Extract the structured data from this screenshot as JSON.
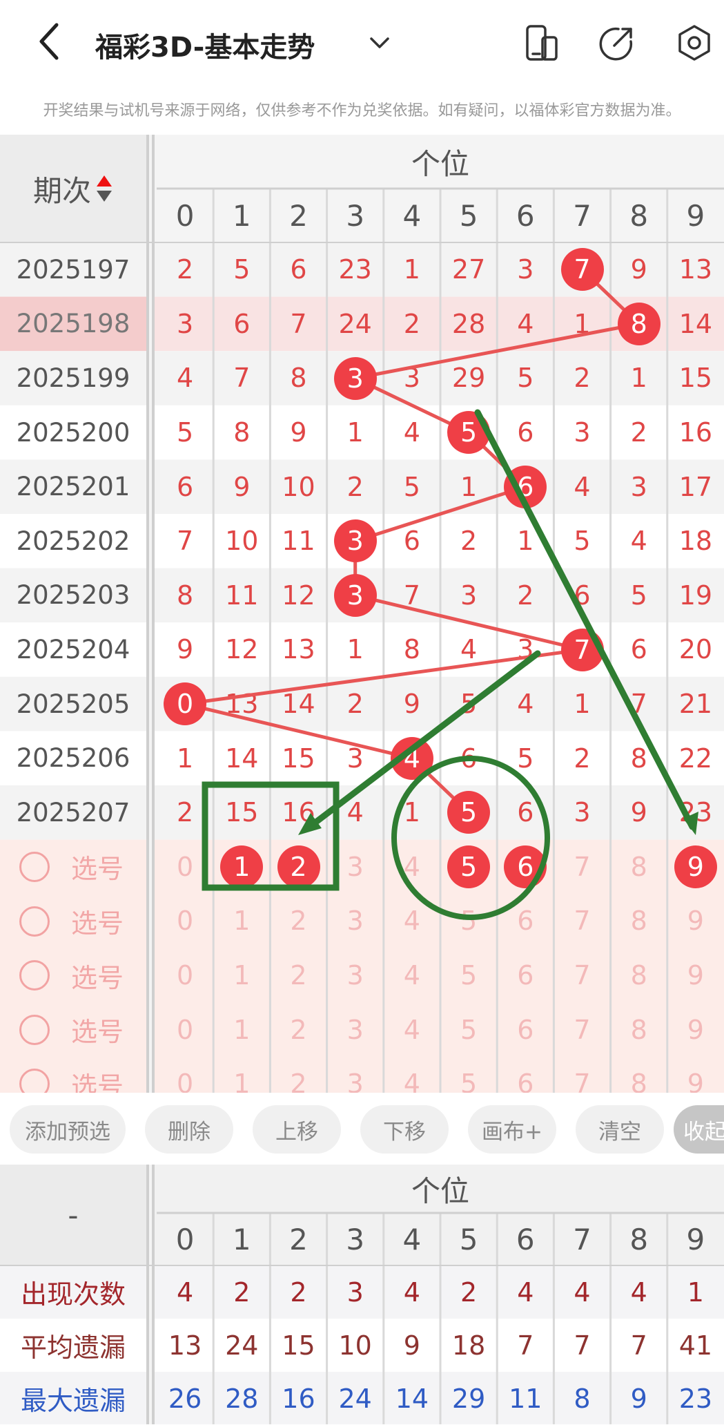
{
  "header": {
    "title": "福彩3D-基本走势",
    "notice": "开奖结果与试机号来源于网络，仅供参考不作为兑奖依据。如有疑问，以福体彩官方数据为准。"
  },
  "colors": {
    "accent": "#ef3f46",
    "number_red": "#e04646",
    "overlay_green": "#2f7d32"
  },
  "grid": {
    "section_title": "个位",
    "issue_header": "期次",
    "digits": [
      "0",
      "1",
      "2",
      "3",
      "4",
      "5",
      "6",
      "7",
      "8",
      "9"
    ],
    "rows": [
      {
        "issue": "2025197",
        "values": [
          "2",
          "5",
          "6",
          "23",
          "1",
          "27",
          "3",
          "7",
          "9",
          "13"
        ],
        "hit": 7
      },
      {
        "issue": "2025198",
        "values": [
          "3",
          "6",
          "7",
          "24",
          "2",
          "28",
          "4",
          "1",
          "8",
          "14"
        ],
        "hit": 8
      },
      {
        "issue": "2025199",
        "values": [
          "4",
          "7",
          "8",
          "3",
          "3",
          "29",
          "5",
          "2",
          "1",
          "15"
        ],
        "hit": 3
      },
      {
        "issue": "2025200",
        "values": [
          "5",
          "8",
          "9",
          "1",
          "4",
          "5",
          "6",
          "3",
          "2",
          "16"
        ],
        "hit": 5
      },
      {
        "issue": "2025201",
        "values": [
          "6",
          "9",
          "10",
          "2",
          "5",
          "1",
          "6",
          "4",
          "3",
          "17"
        ],
        "hit": 6
      },
      {
        "issue": "2025202",
        "values": [
          "7",
          "10",
          "11",
          "3",
          "6",
          "2",
          "1",
          "5",
          "4",
          "18"
        ],
        "hit": 3
      },
      {
        "issue": "2025203",
        "values": [
          "8",
          "11",
          "12",
          "3",
          "7",
          "3",
          "2",
          "6",
          "5",
          "19"
        ],
        "hit": 3
      },
      {
        "issue": "2025204",
        "values": [
          "9",
          "12",
          "13",
          "1",
          "8",
          "4",
          "3",
          "7",
          "6",
          "20"
        ],
        "hit": 7
      },
      {
        "issue": "2025205",
        "values": [
          "0",
          "13",
          "14",
          "2",
          "9",
          "5",
          "4",
          "1",
          "7",
          "21"
        ],
        "hit": 0
      },
      {
        "issue": "2025206",
        "values": [
          "1",
          "14",
          "15",
          "3",
          "4",
          "6",
          "5",
          "2",
          "8",
          "22"
        ],
        "hit": 4
      },
      {
        "issue": "2025207",
        "values": [
          "2",
          "15",
          "16",
          "4",
          "1",
          "5",
          "6",
          "3",
          "9",
          "23"
        ],
        "hit": 5
      }
    ],
    "pick_label": "选号",
    "pick_rows": [
      {
        "selected": [
          1,
          2,
          5,
          6,
          9
        ]
      },
      {
        "selected": []
      },
      {
        "selected": []
      },
      {
        "selected": []
      },
      {
        "selected": []
      }
    ]
  },
  "toolbar": {
    "buttons": [
      "添加预选",
      "删除",
      "上移",
      "下移",
      "画布+",
      "清空",
      "收起"
    ]
  },
  "stats": {
    "section_title": "个位",
    "corner": "-",
    "digits": [
      "0",
      "1",
      "2",
      "3",
      "4",
      "5",
      "6",
      "7",
      "8",
      "9"
    ],
    "rows": [
      {
        "label": "出现次数",
        "color": "#a3262b",
        "values": [
          "4",
          "2",
          "2",
          "3",
          "4",
          "2",
          "4",
          "4",
          "4",
          "1"
        ]
      },
      {
        "label": "平均遗漏",
        "color": "#8d3330",
        "values": [
          "13",
          "24",
          "15",
          "10",
          "9",
          "18",
          "7",
          "7",
          "7",
          "41"
        ]
      },
      {
        "label": "最大遗漏",
        "color": "#2f5bc4",
        "values": [
          "26",
          "28",
          "16",
          "24",
          "14",
          "29",
          "11",
          "8",
          "9",
          "23"
        ]
      }
    ]
  }
}
